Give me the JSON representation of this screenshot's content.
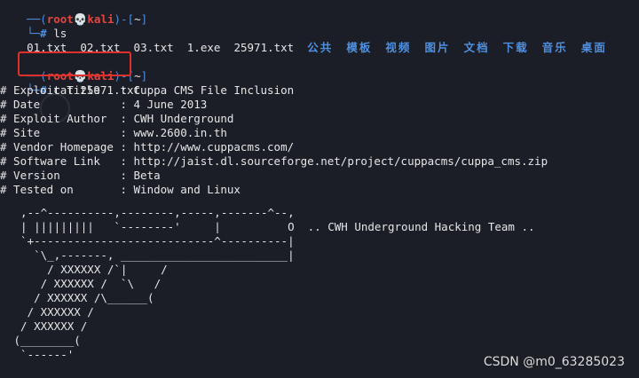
{
  "prompt1": {
    "open": "──(",
    "user": "root",
    "skull": "💀",
    "host": "kali",
    "mid": ")-[",
    "dir": "~",
    "close": "]",
    "hash": "└─#",
    "command": " ls"
  },
  "ls_output": {
    "files": [
      "01.txt",
      "02.txt",
      "03.txt",
      "1.exe",
      "25971.txt"
    ],
    "folders": [
      "公共",
      "模板",
      "视频",
      "图片",
      "文档",
      "下载",
      "音乐",
      "桌面"
    ]
  },
  "prompt2": {
    "open": "──(",
    "user": "root",
    "skull": "💀",
    "host": "kali",
    "mid": ")-[",
    "dir": "~",
    "close": "]",
    "hash": "└─#",
    "command": " cat 25971.txt"
  },
  "file_lines": [
    "# Exploit Title   : Cuppa CMS File Inclusion",
    "# Date            : 4 June 2013",
    "# Exploit Author  : CWH Underground",
    "# Site            : www.2600.in.th",
    "# Vendor Homepage : http://www.cuppacms.com/",
    "# Software Link   : http://jaist.dl.sourceforge.net/project/cuppacms/cuppa_cms.zip",
    "# Version         : Beta",
    "# Tested on       : Window and Linux"
  ],
  "ascii_art": "  ,--^----------,--------,-----,-------^--,\n  | |||||||||   `--------'     |          O  .. CWH Underground Hacking Team ..\n  `+---------------------------^----------|\n    `\\_,-------, _________________________|\n      / XXXXXX /`|     /\n     / XXXXXX /  `\\   /\n    / XXXXXX /\\______(\n   / XXXXXX /\n  / XXXXXX /\n (________(\n  `------'",
  "watermark": "CSDN @m0_63285023"
}
